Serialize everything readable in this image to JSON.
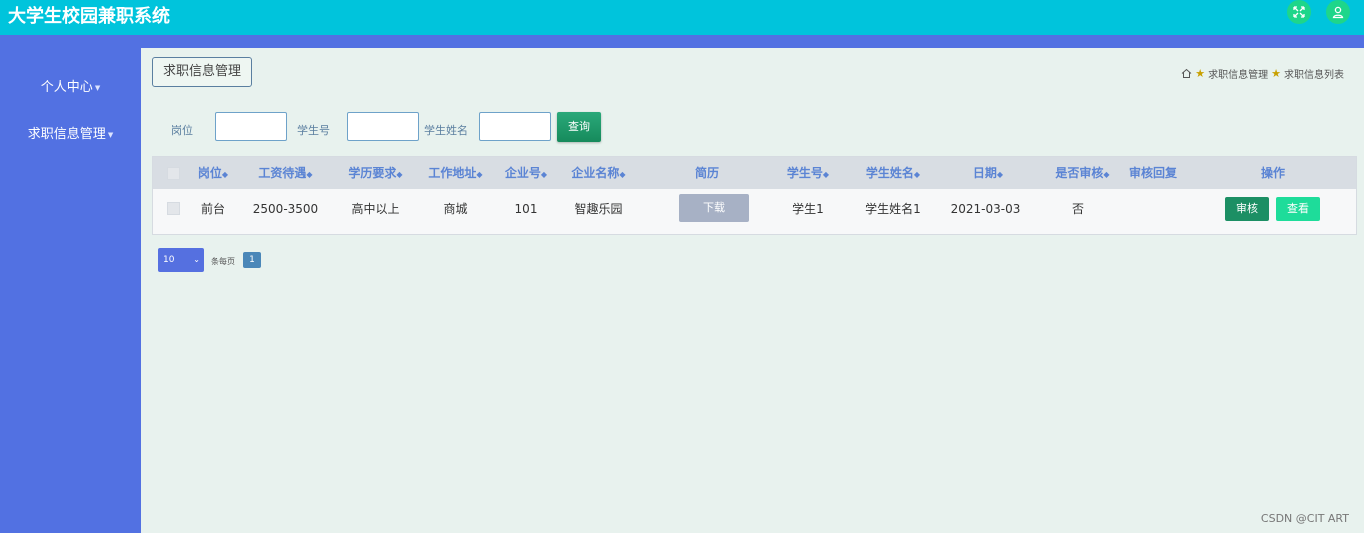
{
  "app": {
    "title": "大学生校园兼职系统"
  },
  "header_icons": [
    "fullscreen-icon",
    "user-icon"
  ],
  "sidebar": {
    "items": [
      {
        "label": "个人中心"
      },
      {
        "label": "求职信息管理"
      }
    ]
  },
  "page": {
    "title_button": "求职信息管理",
    "breadcrumb": [
      "求职信息管理",
      "求职信息列表"
    ]
  },
  "search": {
    "fields": [
      {
        "label": "岗位",
        "value": ""
      },
      {
        "label": "学生号",
        "value": ""
      },
      {
        "label": "学生姓名",
        "value": ""
      }
    ],
    "button_label": "查询"
  },
  "table": {
    "headers": [
      "岗位",
      "工资待遇",
      "学历要求",
      "工作地址",
      "企业号",
      "企业名称",
      "简历",
      "学生号",
      "学生姓名",
      "日期",
      "是否审核",
      "审核回复",
      "操作"
    ],
    "rows": [
      {
        "position": "前台",
        "salary": "2500-3500",
        "education": "高中以上",
        "address": "商城",
        "company_no": "101",
        "company_name": "智趣乐园",
        "resume_button": "下载",
        "student_no": "学生1",
        "student_name": "学生姓名1",
        "date": "2021-03-03",
        "audited": "否",
        "reply": "",
        "audit_button": "审核",
        "view_button": "查看"
      }
    ]
  },
  "pagination": {
    "page_size": "10",
    "page_size_label": "条每页",
    "current_page": "1"
  },
  "watermark": "CSDN @CIT ART",
  "colors": {
    "topbar": "#00c4dc",
    "sidebar": "#5271e2",
    "accent_green": "#1c8f64",
    "view_green": "#1edc9a",
    "header_text": "#5b84d4"
  }
}
